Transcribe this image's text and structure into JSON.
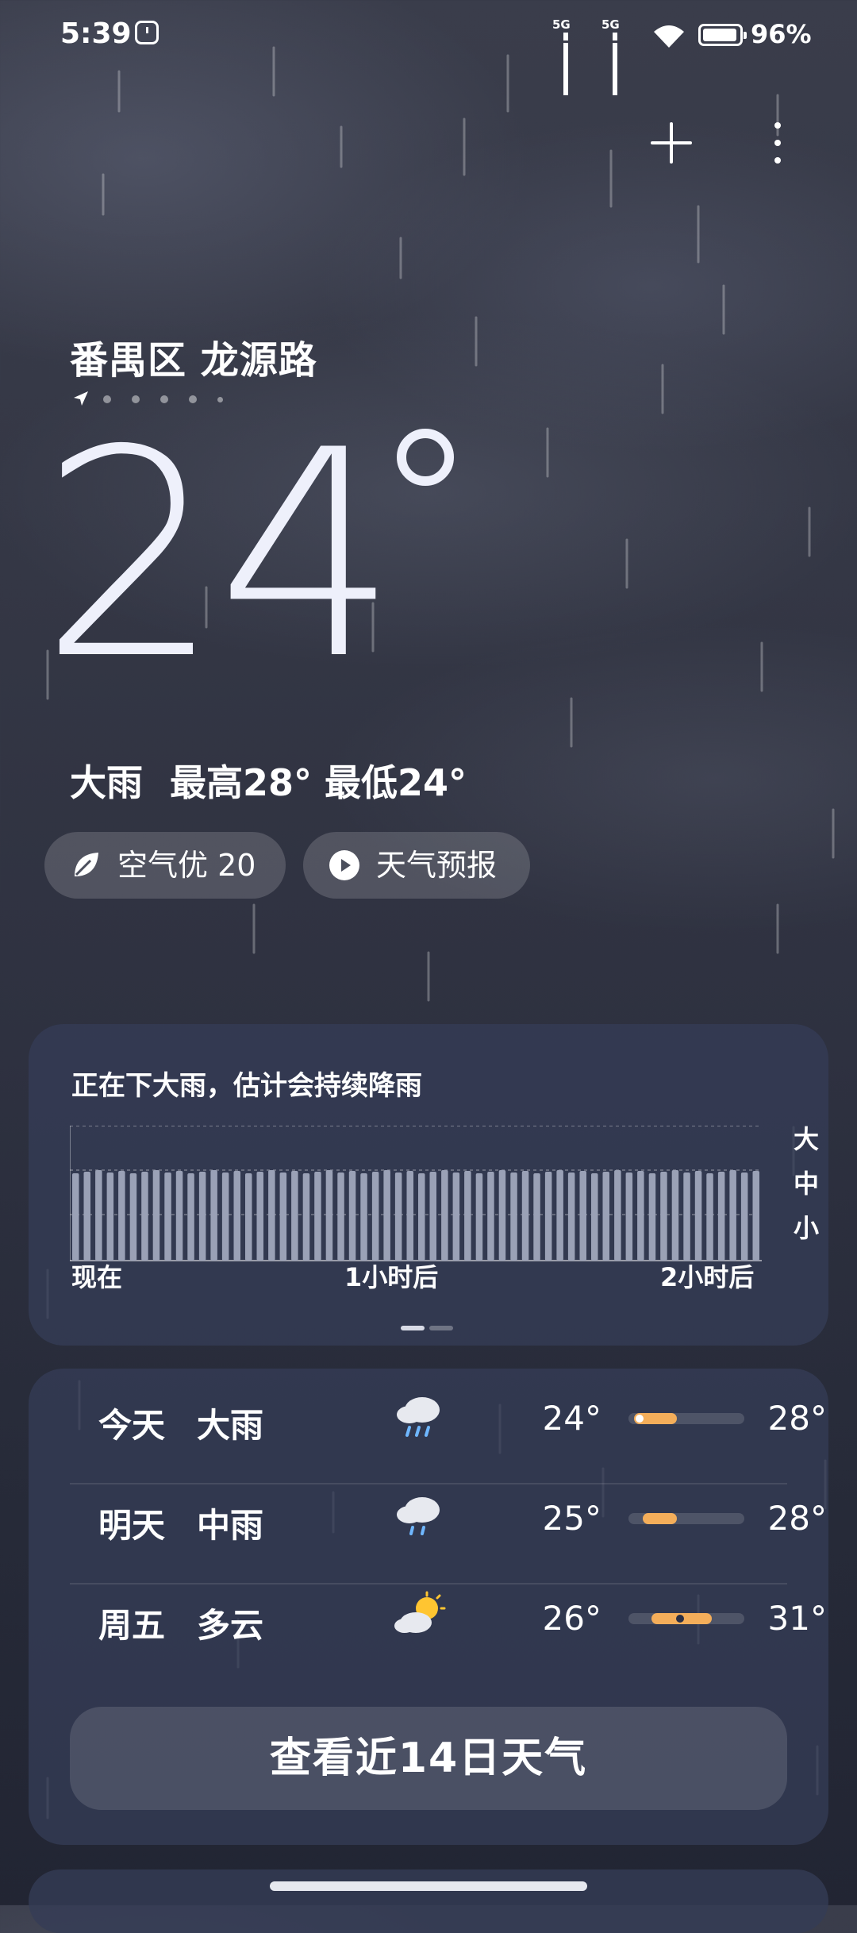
{
  "status_bar": {
    "time": "5:39",
    "network_1": "5G",
    "network_2": "5G",
    "battery": "96%"
  },
  "location": {
    "name": "番禺区 龙源路",
    "page_count": 6
  },
  "current": {
    "temperature": "24",
    "condition": "大雨",
    "high": "最高28°",
    "low": "最低24°"
  },
  "chips": {
    "air_quality": "空气优 20",
    "forecast_video": "天气预报"
  },
  "precipitation": {
    "summary": "正在下大雨，估计会持续降雨",
    "levels": [
      "大",
      "中",
      "小"
    ],
    "time_labels": [
      "现在",
      "1小时后",
      "2小时后"
    ],
    "pages": 2,
    "active_page": 0
  },
  "daily": [
    {
      "day": "今天",
      "condition": "大雨",
      "icon": "heavy-rain-icon",
      "low": "24°",
      "high": "28°",
      "range": [
        0.05,
        0.42
      ],
      "current": 0.05
    },
    {
      "day": "明天",
      "condition": "中雨",
      "icon": "moderate-rain-icon",
      "low": "25°",
      "high": "28°",
      "range": [
        0.12,
        0.42
      ],
      "current": null
    },
    {
      "day": "周五",
      "condition": "多云",
      "icon": "partly-cloudy-icon",
      "low": "26°",
      "high": "31°",
      "range": [
        0.2,
        0.72
      ],
      "current": 0.4
    }
  ],
  "buttons": {
    "fourteen_day": "查看近14日天气"
  },
  "colors": {
    "accent": "#f4ae5a",
    "card": "#343c56",
    "background": "#2e3140"
  }
}
